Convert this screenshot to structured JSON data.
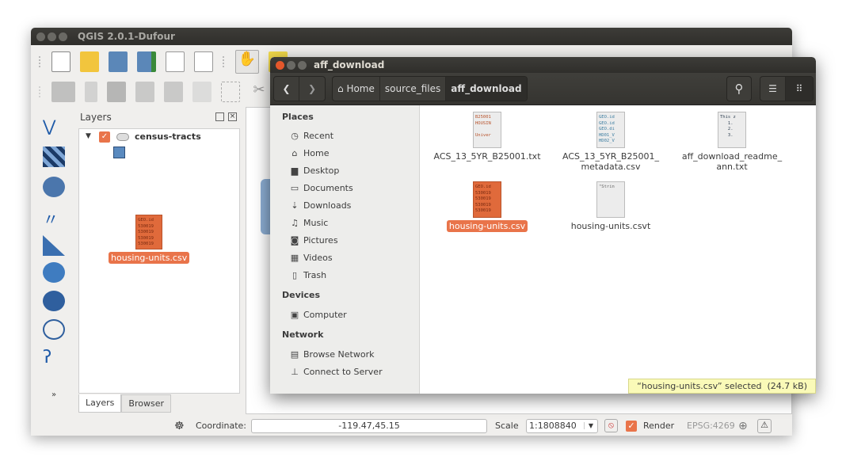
{
  "qgis": {
    "title": "QGIS 2.0.1-Dufour",
    "layers_panel": {
      "title": "Layers",
      "layer": "census-tracts",
      "tabs": [
        "Layers",
        "Browser"
      ]
    },
    "dragged_file": "housing-units.csv",
    "status": {
      "coordinate_label": "Coordinate:",
      "coordinate_value": "-119.47,45.15",
      "scale_label": "Scale",
      "scale_value": "1:1808840",
      "render_label": "Render",
      "render_checked": true,
      "crs": "EPSG:4269"
    }
  },
  "files": {
    "title": "aff_download",
    "breadcrumb": [
      "Home",
      "source_files",
      "aff_download"
    ],
    "sidebar": {
      "sections": [
        {
          "title": "Places",
          "items": [
            {
              "label": "Recent",
              "icon": "clock-icon"
            },
            {
              "label": "Home",
              "icon": "home-icon"
            },
            {
              "label": "Desktop",
              "icon": "desktop-icon"
            },
            {
              "label": "Documents",
              "icon": "folder-icon"
            },
            {
              "label": "Downloads",
              "icon": "download-icon"
            },
            {
              "label": "Music",
              "icon": "music-icon"
            },
            {
              "label": "Pictures",
              "icon": "camera-icon"
            },
            {
              "label": "Videos",
              "icon": "film-icon"
            },
            {
              "label": "Trash",
              "icon": "trash-icon"
            }
          ]
        },
        {
          "title": "Devices",
          "items": [
            {
              "label": "Computer",
              "icon": "drive-icon"
            }
          ]
        },
        {
          "title": "Network",
          "items": [
            {
              "label": "Browse Network",
              "icon": "network-icon"
            },
            {
              "label": "Connect to Server",
              "icon": "server-icon"
            }
          ]
        }
      ]
    },
    "items": [
      {
        "name": "ACS_13_5YR_B25001.txt",
        "preview": "B25001\nHOUSIN\n\nUniver",
        "selected": false
      },
      {
        "name": "ACS_13_5YR_B25001_ metadata.csv",
        "preview": "GEO.id\nGEO.id\nGEO.di\nHD01_V\nHD02_V",
        "selected": false
      },
      {
        "name": "aff_download_readme_ ann.txt",
        "preview": "This z\n   1.\n   2.\n   3.",
        "selected": false
      },
      {
        "name": "housing-units.csv",
        "preview": "GEO.id\n530019\n530019\n530019\n530019",
        "selected": true
      },
      {
        "name": "housing-units.csvt",
        "preview": "\"Strin",
        "selected": false
      }
    ],
    "status": "“housing-units.csv” selected  (24.7 kB)"
  },
  "colors": {
    "accent": "#e9744a",
    "titlebar": "#3a3935"
  }
}
